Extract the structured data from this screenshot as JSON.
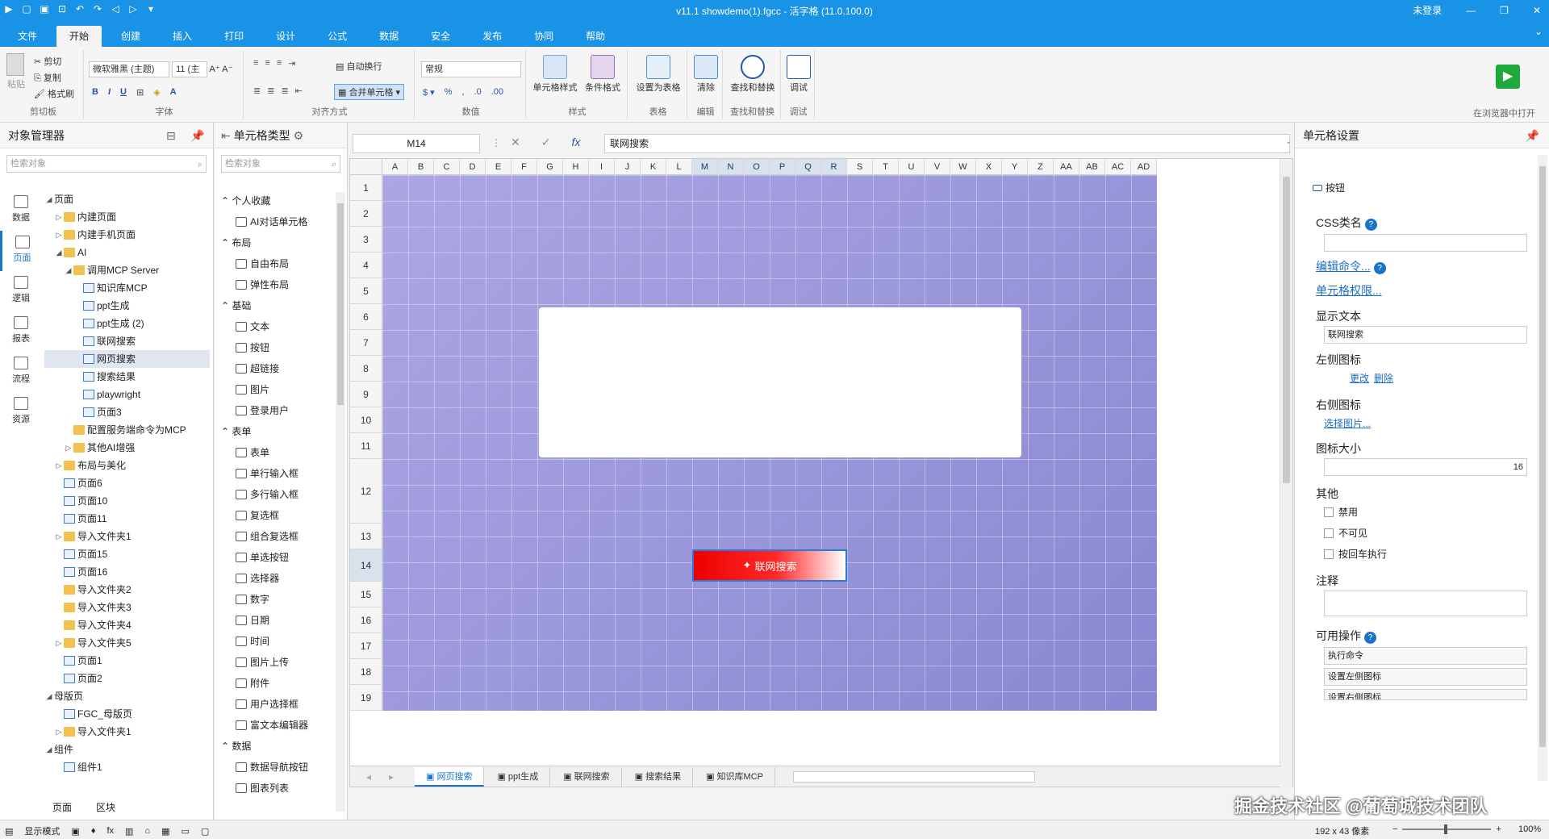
{
  "titlebar": {
    "title": "v11.1 showdemo(1).fgcc - 活字格 (11.0.100.0)",
    "login": "未登录",
    "min": "—",
    "restore": "❐",
    "close": "✕"
  },
  "tabs": [
    "文件",
    "开始",
    "创建",
    "插入",
    "打印",
    "设计",
    "公式",
    "数据",
    "安全",
    "发布",
    "协同",
    "帮助"
  ],
  "ribbon": {
    "clipboard": {
      "paste": "粘贴",
      "cut": "剪切",
      "copy": "复制",
      "format_painter": "格式刷",
      "label": "剪切板"
    },
    "font": {
      "name": "微软雅黑 (主题)",
      "size": "11 (主",
      "label": "字体"
    },
    "align": {
      "wrap": "自动换行",
      "merge": "合并单元格",
      "label": "对齐方式"
    },
    "number": {
      "format": "常规",
      "label": "数值"
    },
    "style": {
      "cell_style": "单元格样式",
      "cond_format": "条件格式",
      "label": "样式"
    },
    "table": {
      "set_table": "设置为表格",
      "label": "表格"
    },
    "edit": {
      "clear": "清除",
      "label": "编辑"
    },
    "find": {
      "find_replace": "查找和替换",
      "label": "查找和替换"
    },
    "debug": {
      "debug": "调试",
      "label": "调试"
    },
    "run": {
      "label": "在浏览器中打开"
    }
  },
  "objmgr": {
    "title": "对象管理器",
    "search_placeholder": "检索对象",
    "side": [
      "数据",
      "页面",
      "逻辑",
      "报表",
      "流程",
      "资源"
    ],
    "tree": [
      {
        "label": "页面",
        "depth": 0,
        "arrow": "◢",
        "type": "none"
      },
      {
        "label": "内建页面",
        "depth": 1,
        "arrow": "▷",
        "type": "folder"
      },
      {
        "label": "内建手机页面",
        "depth": 1,
        "arrow": "▷",
        "type": "folder"
      },
      {
        "label": "AI",
        "depth": 1,
        "arrow": "◢",
        "type": "folder"
      },
      {
        "label": "调用MCP Server",
        "depth": 2,
        "arrow": "◢",
        "type": "folder"
      },
      {
        "label": "知识库MCP",
        "depth": 3,
        "arrow": "",
        "type": "page"
      },
      {
        "label": "ppt生成",
        "depth": 3,
        "arrow": "",
        "type": "page"
      },
      {
        "label": "ppt生成 (2)",
        "depth": 3,
        "arrow": "",
        "type": "page"
      },
      {
        "label": "联网搜索",
        "depth": 3,
        "arrow": "",
        "type": "page"
      },
      {
        "label": "网页搜索",
        "depth": 3,
        "arrow": "",
        "type": "page",
        "sel": true
      },
      {
        "label": "搜索结果",
        "depth": 3,
        "arrow": "",
        "type": "page"
      },
      {
        "label": "playwright",
        "depth": 3,
        "arrow": "",
        "type": "page"
      },
      {
        "label": "页面3",
        "depth": 3,
        "arrow": "",
        "type": "page"
      },
      {
        "label": "配置服务端命令为MCP",
        "depth": 2,
        "arrow": "",
        "type": "folder"
      },
      {
        "label": "其他AI增强",
        "depth": 2,
        "arrow": "▷",
        "type": "folder"
      },
      {
        "label": "布局与美化",
        "depth": 1,
        "arrow": "▷",
        "type": "folder"
      },
      {
        "label": "页面6",
        "depth": 1,
        "arrow": "",
        "type": "page"
      },
      {
        "label": "页面10",
        "depth": 1,
        "arrow": "",
        "type": "page"
      },
      {
        "label": "页面11",
        "depth": 1,
        "arrow": "",
        "type": "page"
      },
      {
        "label": "导入文件夹1",
        "depth": 1,
        "arrow": "▷",
        "type": "folder"
      },
      {
        "label": "页面15",
        "depth": 1,
        "arrow": "",
        "type": "page"
      },
      {
        "label": "页面16",
        "depth": 1,
        "arrow": "",
        "type": "page"
      },
      {
        "label": "导入文件夹2",
        "depth": 1,
        "arrow": "",
        "type": "folder"
      },
      {
        "label": "导入文件夹3",
        "depth": 1,
        "arrow": "",
        "type": "folder"
      },
      {
        "label": "导入文件夹4",
        "depth": 1,
        "arrow": "",
        "type": "folder"
      },
      {
        "label": "导入文件夹5",
        "depth": 1,
        "arrow": "▷",
        "type": "folder"
      },
      {
        "label": "页面1",
        "depth": 1,
        "arrow": "",
        "type": "page"
      },
      {
        "label": "页面2",
        "depth": 1,
        "arrow": "",
        "type": "page"
      },
      {
        "label": "母版页",
        "depth": 0,
        "arrow": "◢",
        "type": "none"
      },
      {
        "label": "FGC_母版页",
        "depth": 1,
        "arrow": "",
        "type": "page"
      },
      {
        "label": "导入文件夹1",
        "depth": 1,
        "arrow": "▷",
        "type": "folder"
      },
      {
        "label": "组件",
        "depth": 0,
        "arrow": "◢",
        "type": "none"
      },
      {
        "label": "组件1",
        "depth": 1,
        "arrow": "",
        "type": "page"
      }
    ],
    "bottom_tabs": [
      "页面",
      "区块"
    ]
  },
  "celltype": {
    "title": "单元格类型",
    "search_placeholder": "检索对象",
    "sections": [
      {
        "name": "个人收藏",
        "items": [
          "AI对话单元格"
        ]
      },
      {
        "name": "布局",
        "items": [
          "自由布局",
          "弹性布局"
        ]
      },
      {
        "name": "基础",
        "items": [
          "文本",
          "按钮",
          "超链接",
          "图片",
          "登录用户"
        ]
      },
      {
        "name": "表单",
        "items": [
          "表单",
          "单行输入框",
          "多行输入框",
          "复选框",
          "组合复选框",
          "单选按钮",
          "选择器",
          "数字",
          "日期",
          "时间",
          "图片上传",
          "附件",
          "用户选择框",
          "富文本编辑器"
        ]
      },
      {
        "name": "数据",
        "items": [
          "数据导航按钮",
          "图表列表"
        ]
      }
    ]
  },
  "formula": {
    "namebox": "M14",
    "cancel": "✕",
    "ok": "✓",
    "fx": "fx",
    "value": "联网搜索"
  },
  "sheet": {
    "columns": [
      "A",
      "B",
      "C",
      "D",
      "E",
      "F",
      "G",
      "H",
      "I",
      "J",
      "K",
      "L",
      "M",
      "N",
      "O",
      "P",
      "Q",
      "R",
      "S",
      "T",
      "U",
      "V",
      "W",
      "X",
      "Y",
      "Z",
      "AA",
      "AB",
      "AC",
      "AD"
    ],
    "rows": [
      "1",
      "2",
      "3",
      "4",
      "5",
      "6",
      "7",
      "8",
      "9",
      "10",
      "11",
      "12",
      "13",
      "14",
      "15",
      "16",
      "17",
      "18",
      "19"
    ],
    "selected_row": "14",
    "button_label": "联网搜索",
    "tabs": [
      "网页搜索",
      "ppt生成",
      "联网搜索",
      "搜索结果",
      "知识库MCP"
    ],
    "active_tab": "网页搜索"
  },
  "settings": {
    "title": "单元格设置",
    "type": "按钮",
    "css_label": "CSS类名",
    "edit_command": "编辑命令...",
    "permission": "单元格权限...",
    "display_text_label": "显示文本",
    "display_text": "联网搜索",
    "left_icon_label": "左侧图标",
    "left_icon_change": "更改",
    "left_icon_delete": "删除",
    "right_icon_label": "右侧图标",
    "right_icon_select": "选择图片...",
    "icon_size_label": "图标大小",
    "icon_size": "16",
    "other_label": "其他",
    "disable": "禁用",
    "invisible": "不可见",
    "enter_exec": "按回车执行",
    "note_label": "注释",
    "ops_label": "可用操作",
    "ops": [
      "执行命令",
      "设置左侧图标",
      "设置右侧图标"
    ]
  },
  "statusbar": {
    "mode": "显示模式",
    "size": "192 x 43 像素",
    "zoom": "100%"
  },
  "watermark": "掘金技术社区 @葡萄城技术团队"
}
